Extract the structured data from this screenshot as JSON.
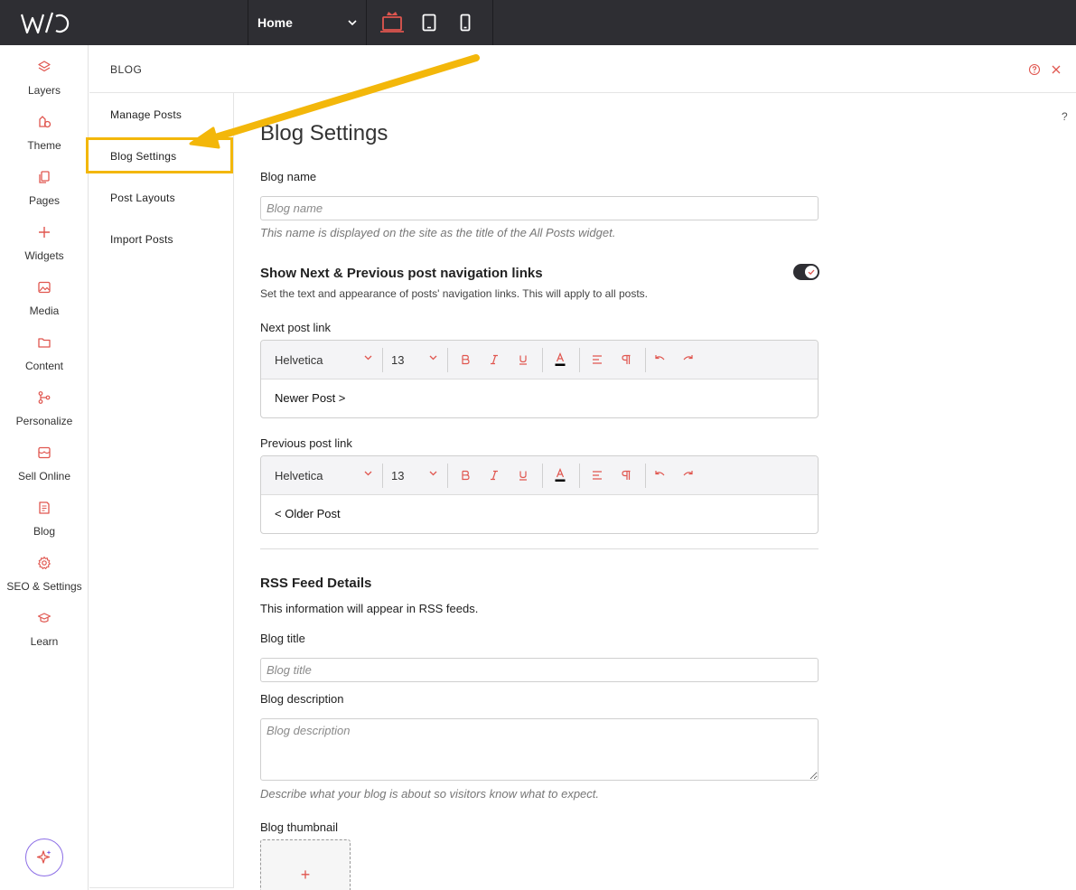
{
  "topbar": {
    "page_selected": "Home"
  },
  "sidebar": {
    "items": [
      {
        "label": "Layers",
        "icon": "layers-icon"
      },
      {
        "label": "Theme",
        "icon": "theme-icon"
      },
      {
        "label": "Pages",
        "icon": "pages-icon"
      },
      {
        "label": "Widgets",
        "icon": "plus-icon"
      },
      {
        "label": "Media",
        "icon": "image-icon"
      },
      {
        "label": "Content",
        "icon": "folder-icon"
      },
      {
        "label": "Personalize",
        "icon": "personalize-icon"
      },
      {
        "label": "Sell Online",
        "icon": "store-icon"
      },
      {
        "label": "Blog",
        "icon": "blog-icon"
      },
      {
        "label": "SEO & Settings",
        "icon": "gear-icon"
      },
      {
        "label": "Learn",
        "icon": "graduation-cap-icon"
      }
    ]
  },
  "panel": {
    "title": "BLOG"
  },
  "subnav": {
    "items": [
      "Manage Posts",
      "Blog Settings",
      "Post Layouts",
      "Import Posts"
    ]
  },
  "help": "?",
  "content": {
    "heading": "Blog Settings",
    "blog_name_label": "Blog name",
    "blog_name_placeholder": "Blog name",
    "blog_name_hint": "This name is displayed on the site as the title of the All Posts widget.",
    "nav_title": "Show Next & Previous post navigation links",
    "nav_desc": "Set the text and appearance of posts' navigation links. This will apply to all posts.",
    "next_label": "Next post link",
    "next_editor": {
      "font": "Helvetica",
      "size": "13",
      "text": "Newer Post >"
    },
    "prev_label": "Previous post link",
    "prev_editor": {
      "font": "Helvetica",
      "size": "13",
      "text": "< Older Post"
    },
    "rss_title": "RSS Feed Details",
    "rss_desc": "This information will appear in RSS feeds.",
    "blog_title_label": "Blog title",
    "blog_title_placeholder": "Blog title",
    "blog_desc_label": "Blog description",
    "blog_desc_placeholder": "Blog description",
    "blog_desc_hint": "Describe what your blog is about so visitors know what to expect.",
    "thumb_label": "Blog thumbnail",
    "thumb_plus": "+"
  },
  "colors": {
    "accent": "#e0564f",
    "topbar": "#2e2e33",
    "highlight": "#f3b70a"
  }
}
